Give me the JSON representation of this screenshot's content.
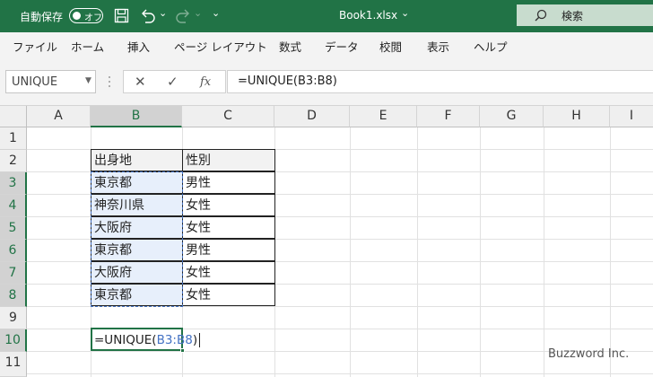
{
  "titlebar": {
    "autosave_label": "自動保存",
    "autosave_state": "オフ",
    "redo_dropdown": "⌄",
    "qat_more": "⌄",
    "filename": "Book1.xlsx",
    "filename_caret": "⌄",
    "search_placeholder": "検索"
  },
  "menu": {
    "items": [
      "ファイル",
      "ホーム",
      "挿入",
      "ページ レイアウト",
      "数式",
      "データ",
      "校閲",
      "表示",
      "ヘルプ"
    ]
  },
  "formula_bar": {
    "name_box": "UNIQUE",
    "name_box_caret": "▼",
    "cancel_symbol": "✕",
    "enter_symbol": "✓",
    "fx_symbol": "fx",
    "formula": "=UNIQUE(B3:B8)"
  },
  "grid": {
    "columns": [
      "A",
      "B",
      "C",
      "D",
      "E",
      "F",
      "G",
      "H",
      "I"
    ],
    "rows": [
      "1",
      "2",
      "3",
      "4",
      "5",
      "6",
      "7",
      "8",
      "9",
      "10",
      "11"
    ],
    "table": {
      "header": [
        "出身地",
        "性別"
      ],
      "rows": [
        [
          "東京都",
          "男性"
        ],
        [
          "神奈川県",
          "女性"
        ],
        [
          "大阪府",
          "女性"
        ],
        [
          "東京都",
          "男性"
        ],
        [
          "大阪府",
          "女性"
        ],
        [
          "東京都",
          "女性"
        ]
      ]
    },
    "edit_cell": {
      "prefix": "=UNIQUE(",
      "ref": "B3:B8",
      "suffix": ")"
    }
  },
  "watermark": "Buzzword Inc.",
  "colors": {
    "excel_green": "#217346",
    "selection_fill": "#e7effb",
    "reference_blue": "#4472c4"
  }
}
